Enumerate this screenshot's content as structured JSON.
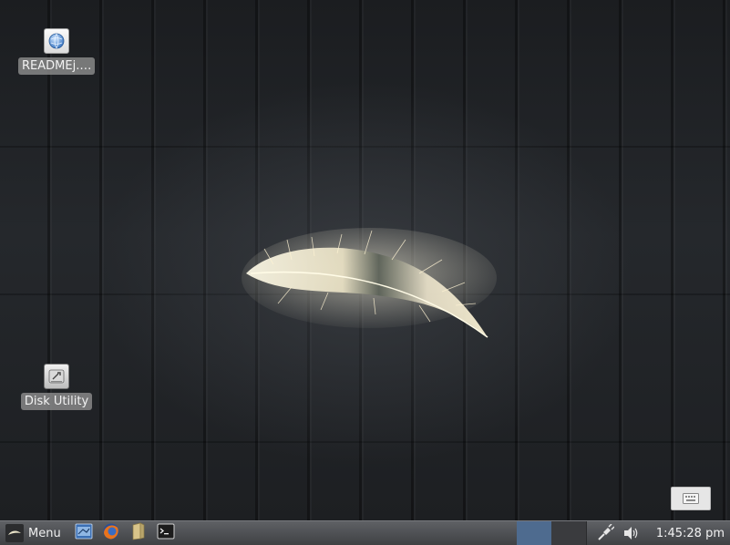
{
  "desktop": {
    "icons": [
      {
        "label": "READMEj.…",
        "icon": "web-document-icon"
      },
      {
        "label": "Disk Utility",
        "icon": "disk-utility-icon"
      }
    ],
    "wallpaper": "feather-on-dark-wood"
  },
  "taskbar": {
    "menu_label": "Menu",
    "launchers": [
      "file-manager-icon",
      "firefox-icon",
      "folder-icon",
      "terminal-icon"
    ],
    "workspaces": [
      {
        "active": true
      },
      {
        "active": false
      }
    ],
    "tray": [
      "network-icon",
      "volume-icon"
    ],
    "clock": "1:45:28 pm"
  },
  "colors": {
    "taskbar": "#4f5154",
    "active_workspace": "#4e6b8f",
    "icon_label_bg": "#969696"
  }
}
